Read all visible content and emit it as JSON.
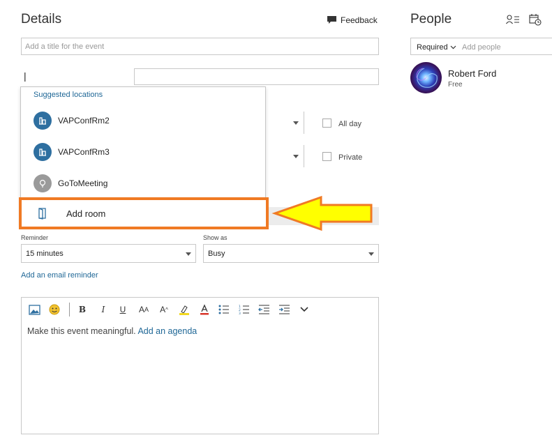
{
  "details": {
    "heading": "Details",
    "feedback_label": "Feedback",
    "title_placeholder": "Add a title for the event",
    "location_value": "|"
  },
  "suggestions": {
    "header": "Suggested locations",
    "items": [
      {
        "label": "VAPConfRm2",
        "icon": "building-icon",
        "color": "#2e6fa0"
      },
      {
        "label": "VAPConfRm3",
        "icon": "building-icon",
        "color": "#2e6fa0"
      },
      {
        "label": "GoToMeeting",
        "icon": "lightbulb-icon",
        "color": "#9a9a9a"
      }
    ],
    "add_room_label": "Add room"
  },
  "options": {
    "all_day_label": "All day",
    "private_label": "Private"
  },
  "reminder": {
    "label": "Reminder",
    "value": "15 minutes",
    "show_as_label": "Show as",
    "show_as_value": "Busy",
    "email_reminder_link": "Add an email reminder"
  },
  "editor": {
    "body_text": "Make this event meaningful.",
    "agenda_link": "Add an agenda",
    "toolbar": [
      "image-icon",
      "emoji-icon",
      "bold-icon",
      "italic-icon",
      "underline-icon",
      "font-size-icon",
      "grow-font-icon",
      "highlight-icon",
      "font-color-icon",
      "bullets-icon",
      "numbering-icon",
      "outdent-icon",
      "indent-icon",
      "more-icon"
    ]
  },
  "people": {
    "heading": "People",
    "required_label": "Required",
    "add_people_placeholder": "Add people",
    "attendee_name": "Robert Ford",
    "attendee_status": "Free"
  },
  "annotation": {
    "highlight_color": "#f07a24",
    "arrow_fill": "#ffff00",
    "arrow_stroke": "#f07a24"
  }
}
